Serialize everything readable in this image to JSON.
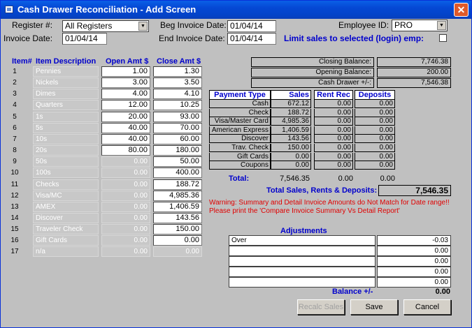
{
  "window": {
    "title": "Cash Drawer Reconciliation - Add Screen",
    "close_label": "✕"
  },
  "filters": {
    "register_label": "Register #:",
    "register_value": "All Registers",
    "beg_invoice_label": "Beg Invoice Date:",
    "beg_invoice_value": "01/04/14",
    "employee_label": "Employee ID:",
    "employee_value": "PRO",
    "invoice_date_label": "Invoice Date:",
    "invoice_date_value": "01/04/14",
    "end_invoice_label": "End Invoice Date:",
    "end_invoice_value": "01/04/14",
    "limit_label": "Limit sales to selected (login) emp:"
  },
  "items_table": {
    "headers": {
      "item": "Item#",
      "desc": "Item Description",
      "open": "Open Amt $",
      "close": "Close Amt $"
    },
    "rows": [
      {
        "num": "1",
        "desc": "Pennies",
        "open": "1.00",
        "close": "1.30",
        "open_editable": true
      },
      {
        "num": "2",
        "desc": "Nickels",
        "open": "3.00",
        "close": "3.50",
        "open_editable": true
      },
      {
        "num": "3",
        "desc": "Dimes",
        "open": "4.00",
        "close": "4.10",
        "open_editable": true
      },
      {
        "num": "4",
        "desc": "Quarters",
        "open": "12.00",
        "close": "10.25",
        "open_editable": true
      },
      {
        "num": "5",
        "desc": "1s",
        "open": "20.00",
        "close": "93.00",
        "open_editable": true
      },
      {
        "num": "6",
        "desc": "5s",
        "open": "40.00",
        "close": "70.00",
        "open_editable": true
      },
      {
        "num": "7",
        "desc": "10s",
        "open": "40.00",
        "close": "60.00",
        "open_editable": true
      },
      {
        "num": "8",
        "desc": "20s",
        "open": "80.00",
        "close": "180.00",
        "open_editable": true
      },
      {
        "num": "9",
        "desc": "50s",
        "open": "0.00",
        "close": "50.00",
        "open_editable": false
      },
      {
        "num": "10",
        "desc": "100s",
        "open": "0.00",
        "close": "400.00",
        "open_editable": false
      },
      {
        "num": "11",
        "desc": "Checks",
        "open": "0.00",
        "close": "188.72",
        "open_editable": false
      },
      {
        "num": "12",
        "desc": "Visa/MC",
        "open": "0.00",
        "close": "4,985.36",
        "open_editable": false
      },
      {
        "num": "13",
        "desc": "AMEX",
        "open": "0.00",
        "close": "1,406.59",
        "open_editable": false
      },
      {
        "num": "14",
        "desc": "Discover",
        "open": "0.00",
        "close": "143.56",
        "open_editable": false
      },
      {
        "num": "15",
        "desc": "Traveler Check",
        "open": "0.00",
        "close": "150.00",
        "open_editable": false
      },
      {
        "num": "16",
        "desc": "Gift Cards",
        "open": "0.00",
        "close": "0.00",
        "open_editable": false
      },
      {
        "num": "17",
        "desc": "n/a",
        "open": "0.00",
        "close": "0.00",
        "open_editable": false,
        "close_editable": false
      }
    ]
  },
  "balances": [
    {
      "label": "Closing Balance:",
      "value": "7,746.38"
    },
    {
      "label": "Opening Balance:",
      "value": "200.00"
    },
    {
      "label": "Cash Drawer +/-:",
      "value": "7,546.38"
    }
  ],
  "payments": {
    "headers": {
      "type": "Payment Type",
      "sales": "Sales",
      "rent": "Rent Rec",
      "deposits": "Deposits"
    },
    "rows": [
      {
        "type": "Cash",
        "sales": "672.12",
        "rent": "0.00",
        "deposits": "0.00"
      },
      {
        "type": "Check",
        "sales": "188.72",
        "rent": "0.00",
        "deposits": "0.00"
      },
      {
        "type": "Visa/Master Card",
        "sales": "4,985.36",
        "rent": "0.00",
        "deposits": "0.00"
      },
      {
        "type": "American Express",
        "sales": "1,406.59",
        "rent": "0.00",
        "deposits": "0.00"
      },
      {
        "type": "Discover",
        "sales": "143.56",
        "rent": "0.00",
        "deposits": "0.00"
      },
      {
        "type": "Trav. Check",
        "sales": "150.00",
        "rent": "0.00",
        "deposits": "0.00"
      },
      {
        "type": "Gift Cards",
        "sales": "0.00",
        "rent": "0.00",
        "deposits": "0.00"
      },
      {
        "type": "Coupons",
        "sales": "0.00",
        "rent": "0.00",
        "deposits": "0.00"
      }
    ],
    "total_label": "Total:",
    "total_sales": "7,546.35",
    "total_rent": "0.00",
    "total_deposits": "0.00",
    "grand_label": "Total Sales, Rents & Deposits:",
    "grand_value": "7,546.35"
  },
  "warning": {
    "line1": "Warning: Summary and Detail Invoice Amounts do Not Match for Date range!!",
    "line2": "Please print the 'Compare Invoice Summary Vs Detail Report'"
  },
  "adjustments": {
    "title": "Adjustments",
    "rows": [
      {
        "desc": "Over",
        "amount": "-0.03"
      },
      {
        "desc": "",
        "amount": "0.00"
      },
      {
        "desc": "",
        "amount": "0.00"
      },
      {
        "desc": "",
        "amount": "0.00"
      },
      {
        "desc": "",
        "amount": "0.00"
      }
    ],
    "balance_label": "Balance +/-",
    "balance_value": "0.00"
  },
  "buttons": {
    "recalc": "Recalc Sales",
    "save": "Save",
    "cancel": "Cancel"
  },
  "colors": {
    "title_bar": "#0548d4",
    "header_blue": "#0000cc",
    "warning_red": "#e00000",
    "window_bg": "#c0c0c0"
  }
}
